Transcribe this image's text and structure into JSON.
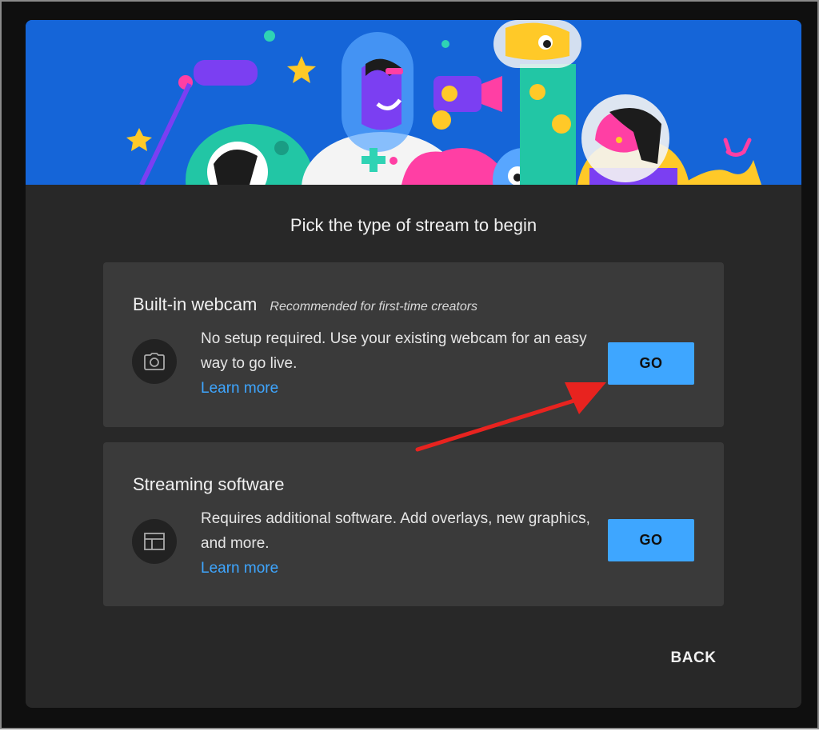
{
  "dialog": {
    "title": "Pick the type of stream to begin"
  },
  "options": [
    {
      "heading": "Built-in webcam",
      "subheading": "Recommended for first-time creators",
      "icon": "camera-icon",
      "description": "No setup required. Use your existing webcam for an easy way to go live.",
      "learn_more": "Learn more",
      "button": "GO"
    },
    {
      "heading": "Streaming software",
      "subheading": "",
      "icon": "layout-icon",
      "description": "Requires additional software. Add overlays, new graphics, and more.",
      "learn_more": "Learn more",
      "button": "GO"
    }
  ],
  "footer": {
    "back_label": "BACK"
  },
  "colors": {
    "accent": "#3ea6ff",
    "banner": "#1565d8",
    "dialog_bg": "#282828",
    "card_bg": "#3a3a3a",
    "annotation_arrow": "#e8231f"
  }
}
